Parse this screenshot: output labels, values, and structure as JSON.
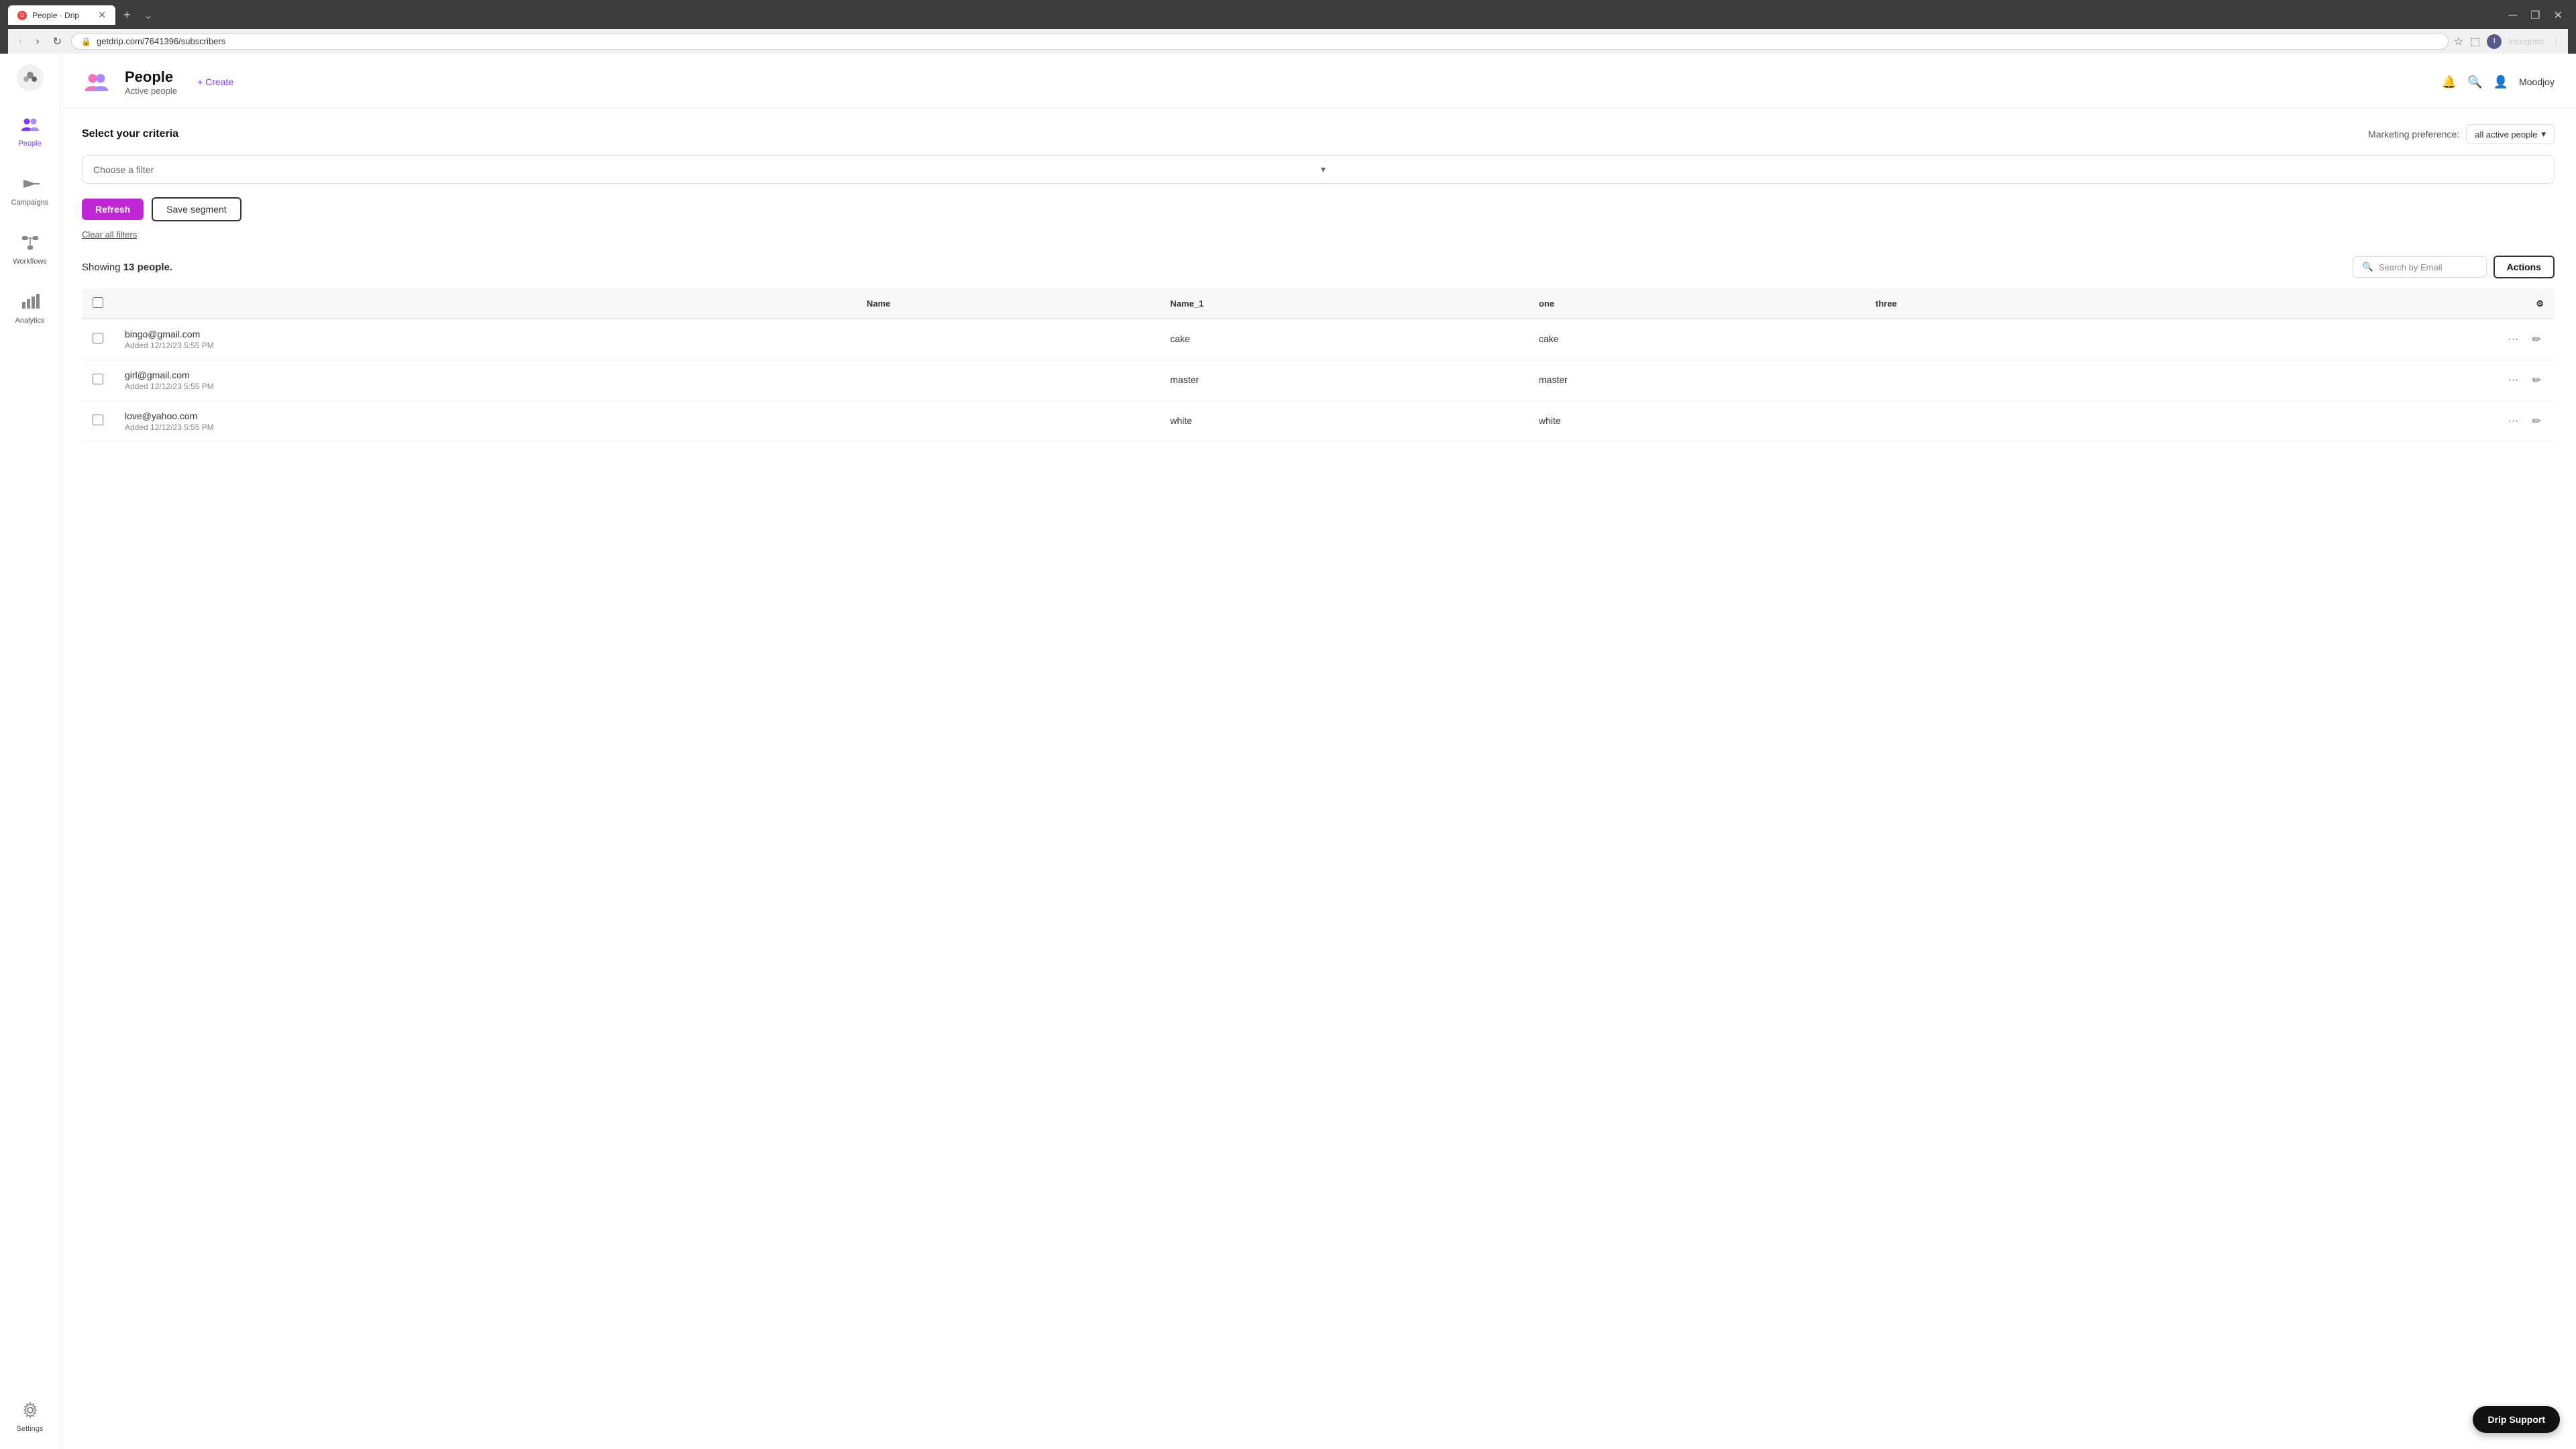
{
  "browser": {
    "tab_favicon": "D",
    "tab_title": "People · Drip",
    "url": "getdrip.com/7641396/subscribers",
    "new_tab_label": "+",
    "user_label": "Incognito"
  },
  "header": {
    "title": "People",
    "subtitle": "Active people",
    "create_label": "+ Create"
  },
  "sidebar": {
    "items": [
      {
        "label": "People",
        "active": true
      },
      {
        "label": "Campaigns",
        "active": false
      },
      {
        "label": "Workflows",
        "active": false
      },
      {
        "label": "Analytics",
        "active": false
      },
      {
        "label": "Settings",
        "active": false
      }
    ]
  },
  "criteria": {
    "section_label": "Select your criteria",
    "filter_placeholder": "Choose a filter",
    "marketing_label": "Marketing preference:",
    "marketing_value": "all active people"
  },
  "actions": {
    "refresh_label": "Refresh",
    "save_segment_label": "Save segment",
    "clear_filters_label": "Clear all filters"
  },
  "table": {
    "showing_prefix": "Showing ",
    "showing_count": "13 people.",
    "search_placeholder": "Search by Email",
    "actions_label": "Actions",
    "columns": [
      {
        "key": "name",
        "label": "Name"
      },
      {
        "key": "name1",
        "label": "Name_1"
      },
      {
        "key": "one",
        "label": "one"
      },
      {
        "key": "three",
        "label": "three"
      }
    ],
    "rows": [
      {
        "email": "bingo@gmail.com",
        "added": "Added 12/12/23 5:55 PM",
        "name": "",
        "name1": "cake",
        "one": "cake",
        "three": ""
      },
      {
        "email": "girl@gmail.com",
        "added": "Added 12/12/23 5:55 PM",
        "name": "",
        "name1": "master",
        "one": "master",
        "three": ""
      },
      {
        "email": "love@yahoo.com",
        "added": "Added 12/12/23 5:55 PM",
        "name": "",
        "name1": "white",
        "one": "white",
        "three": ""
      }
    ]
  },
  "drip_support": {
    "label": "Drip Support"
  }
}
